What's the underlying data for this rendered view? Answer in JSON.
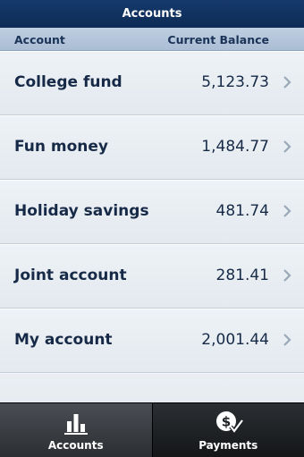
{
  "header": {
    "title": "Accounts"
  },
  "columns": {
    "account": "Account",
    "balance": "Current Balance"
  },
  "accounts": [
    {
      "name": "College fund",
      "balance": "5,123.73"
    },
    {
      "name": "Fun money",
      "balance": "1,484.77"
    },
    {
      "name": "Holiday savings",
      "balance": "481.74"
    },
    {
      "name": "Joint account",
      "balance": "281.41"
    },
    {
      "name": "My account",
      "balance": "2,001.44"
    },
    {
      "name": "",
      "balance": ""
    }
  ],
  "tabs": [
    {
      "label": "Accounts",
      "icon": "bar-chart-icon",
      "active": true
    },
    {
      "label": "Payments",
      "icon": "dollar-check-icon",
      "active": false
    }
  ],
  "colors": {
    "titlebar": "#0d2b55",
    "text": "#162a48",
    "tabbar": "#1e2124"
  }
}
